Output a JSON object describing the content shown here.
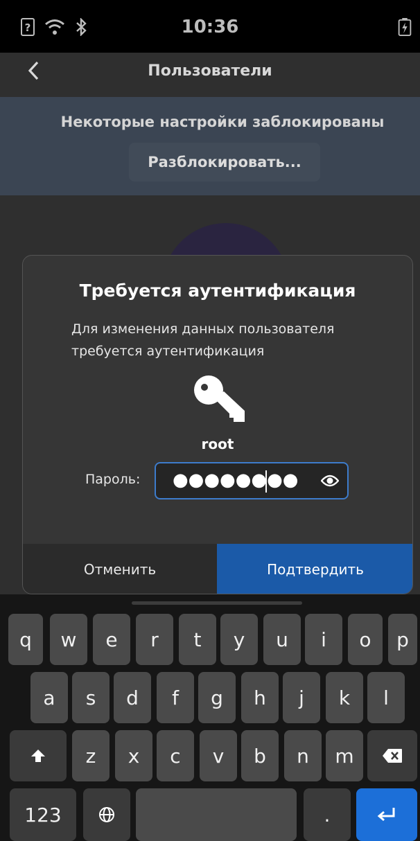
{
  "status_bar": {
    "time": "10:36",
    "icons": [
      "unknown-sim-icon",
      "wifi-icon",
      "bluetooth-icon",
      "battery-charging-icon"
    ]
  },
  "app": {
    "back_icon": "chevron-left-icon",
    "title": "Пользователи",
    "banner_message": "Некоторые настройки заблокированы",
    "unlock_button": "Разблокировать..."
  },
  "dialog": {
    "title": "Требуется аутентификация",
    "description": "Для изменения данных пользователя требуется аутентификация",
    "icon": "key-icon",
    "username": "root",
    "password_label": "Пароль:",
    "password_value": "●●●●●●●●",
    "show_password_icon": "eye-icon",
    "cancel_label": "Отменить",
    "confirm_label": "Подтвердить"
  },
  "keyboard": {
    "row1": [
      "q",
      "w",
      "e",
      "r",
      "t",
      "y",
      "u",
      "i",
      "o",
      "p"
    ],
    "row2": [
      "a",
      "s",
      "d",
      "f",
      "g",
      "h",
      "j",
      "k",
      "l"
    ],
    "row3": [
      "z",
      "x",
      "c",
      "v",
      "b",
      "n",
      "m"
    ],
    "numbers_label": "123",
    "period_label": ".",
    "shift_icon": "shift-icon",
    "backspace_icon": "backspace-icon",
    "globe_icon": "globe-icon",
    "enter_icon": "enter-icon",
    "enter_color": "#1c6fd8"
  }
}
